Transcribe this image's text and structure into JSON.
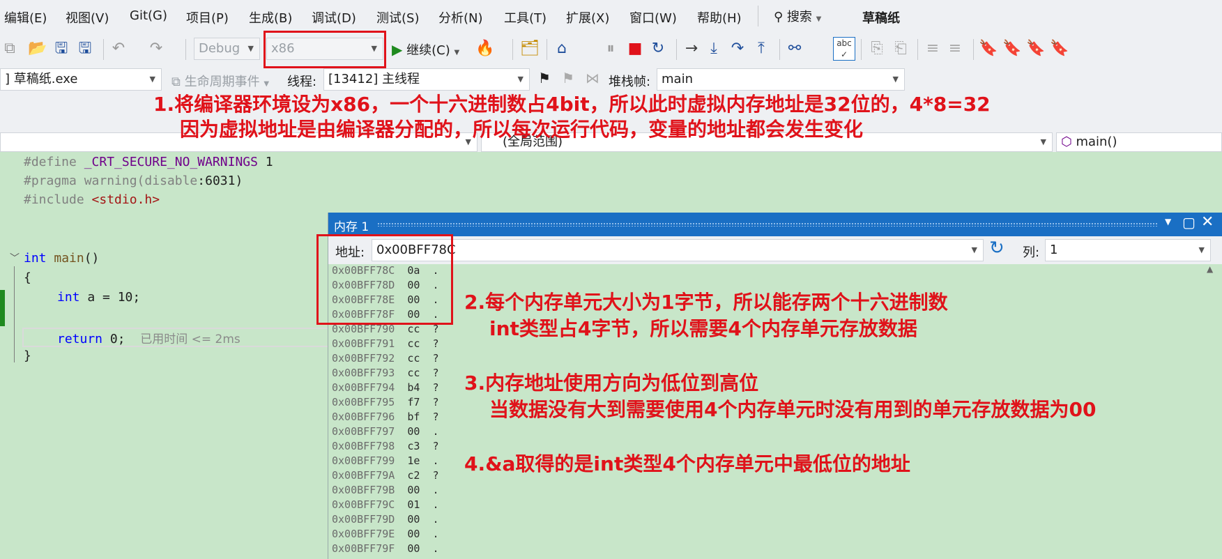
{
  "menu": [
    "编辑(E)",
    "视图(V)",
    "Git(G)",
    "项目(P)",
    "生成(B)",
    "调试(D)",
    "测试(S)",
    "分析(N)",
    "工具(T)",
    "扩展(X)",
    "窗口(W)",
    "帮助(H)"
  ],
  "search_label": "搜索",
  "window_title": "草稿纸",
  "toolbar": {
    "config": "Debug",
    "platform": "x86",
    "continue_label": "继续(C)"
  },
  "toolbar2": {
    "process": "] 草稿纸.exe",
    "lifecycle": "生命周期事件",
    "thread_label": "线程:",
    "thread_value": "[13412] 主线程",
    "stack_label": "堆栈帧:",
    "stack_value": "main"
  },
  "nav": {
    "scope": "(全局范围)",
    "function": "main()"
  },
  "code": {
    "l1_pp": "#define",
    "l1_macro": "_CRT_SECURE_NO_WARNINGS",
    "l1_val": "1",
    "l2_pp": "#pragma",
    "l2_rest_a": "warning(",
    "l2_rest_b": "disable",
    "l2_rest_c": ":6031)",
    "l3_pp": "#include",
    "l3_str": "<stdio.h>",
    "l4_kw": "int",
    "l4_fn": "main",
    "l4_rest": "()",
    "l5": "{",
    "l6_kw": "int",
    "l6_rest": "a = 10;",
    "l7_kw": "return",
    "l7_rest": "0;",
    "l7_hint": "已用时间 <= 2ms",
    "l8": "}"
  },
  "memory": {
    "title": "内存 1",
    "addr_label": "地址:",
    "addr_value": "0x00BFF78C",
    "col_label": "列:",
    "col_value": "1",
    "rows": [
      {
        "a": "0x00BFF78C",
        "v": "0a",
        "c": "."
      },
      {
        "a": "0x00BFF78D",
        "v": "00",
        "c": "."
      },
      {
        "a": "0x00BFF78E",
        "v": "00",
        "c": "."
      },
      {
        "a": "0x00BFF78F",
        "v": "00",
        "c": "."
      },
      {
        "a": "0x00BFF790",
        "v": "cc",
        "c": "?"
      },
      {
        "a": "0x00BFF791",
        "v": "cc",
        "c": "?"
      },
      {
        "a": "0x00BFF792",
        "v": "cc",
        "c": "?"
      },
      {
        "a": "0x00BFF793",
        "v": "cc",
        "c": "?"
      },
      {
        "a": "0x00BFF794",
        "v": "b4",
        "c": "?"
      },
      {
        "a": "0x00BFF795",
        "v": "f7",
        "c": "?"
      },
      {
        "a": "0x00BFF796",
        "v": "bf",
        "c": "?"
      },
      {
        "a": "0x00BFF797",
        "v": "00",
        "c": "."
      },
      {
        "a": "0x00BFF798",
        "v": "c3",
        "c": "?"
      },
      {
        "a": "0x00BFF799",
        "v": "1e",
        "c": "."
      },
      {
        "a": "0x00BFF79A",
        "v": "c2",
        "c": "?"
      },
      {
        "a": "0x00BFF79B",
        "v": "00",
        "c": "."
      },
      {
        "a": "0x00BFF79C",
        "v": "01",
        "c": "."
      },
      {
        "a": "0x00BFF79D",
        "v": "00",
        "c": "."
      },
      {
        "a": "0x00BFF79E",
        "v": "00",
        "c": "."
      },
      {
        "a": "0x00BFF79F",
        "v": "00",
        "c": "."
      }
    ]
  },
  "annotations": {
    "a1_line1": "1.将编译器环境设为x86，一个十六进制数占4bit，所以此时虚拟内存地址是32位的，4*8=32",
    "a1_line2": "因为虚拟地址是由编译器分配的，所以每次运行代码，变量的地址都会发生变化",
    "a2_line1": "2.每个内存单元大小为1字节，所以能存两个十六进制数",
    "a2_line2": "int类型占4字节，所以需要4个内存单元存放数据",
    "a3_line1": "3.内存地址使用方向为低位到高位",
    "a3_line2": "当数据没有大到需要使用4个内存单元时没有用到的单元存放数据为00",
    "a4_line1": "4.&a取得的是int类型4个内存单元中最低位的地址"
  },
  "colors": {
    "annotation": "#e0121a",
    "highlight_box": "#e0121a",
    "editor_bg": "#c8e6c9",
    "title_bar": "#1a6fc4"
  }
}
